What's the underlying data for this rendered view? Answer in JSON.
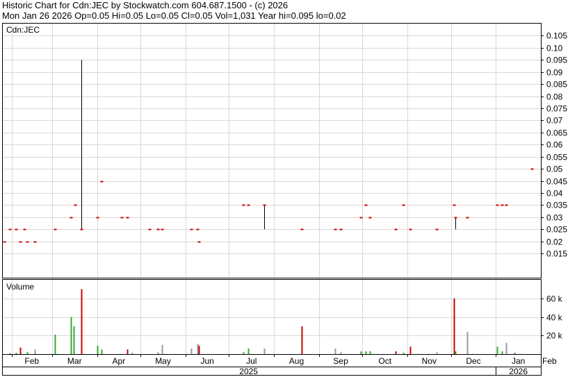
{
  "header": {
    "line1": "Historic Chart for Cdn:JEC by Stockwatch.com 604.687.1500 - (c) 2026",
    "line2": "Mon Jan 26 2026  Op=0.05  Hi=0.05  Lo=0.05  Cl=0.05  Vol=1,031  Year hi=0.095  lo=0.02"
  },
  "chart_data": {
    "type": "line",
    "title": "Historic Chart for Cdn:JEC",
    "price_panel": {
      "label": "Cdn:JEC",
      "ylim": [
        0.005,
        0.11
      ],
      "yticks": [
        0.015,
        0.02,
        0.025,
        0.03,
        0.035,
        0.04,
        0.045,
        0.05,
        0.055,
        0.06,
        0.065,
        0.07,
        0.075,
        0.08,
        0.085,
        0.09,
        0.095,
        0.1,
        0.105
      ],
      "ytick_labels": [
        "0.015",
        "0.02",
        "0.025",
        "0.03",
        "0.035",
        "0.04",
        "0.045",
        "0.05",
        "0.055",
        "0.06",
        "0.065",
        "0.07",
        "0.075",
        "0.08",
        "0.085",
        "0.09",
        "0.095",
        "0.10",
        "0.105"
      ],
      "bars": [
        {
          "date": "2025-01-27",
          "open": 0.02,
          "high": 0.02,
          "low": 0.02,
          "close": 0.02
        },
        {
          "date": "2025-01-31",
          "open": 0.025,
          "high": 0.025,
          "low": 0.025,
          "close": 0.025
        },
        {
          "date": "2025-02-04",
          "open": 0.025,
          "high": 0.025,
          "low": 0.025,
          "close": 0.025
        },
        {
          "date": "2025-02-07",
          "open": 0.02,
          "high": 0.02,
          "low": 0.02,
          "close": 0.02
        },
        {
          "date": "2025-02-10",
          "open": 0.025,
          "high": 0.025,
          "low": 0.025,
          "close": 0.025
        },
        {
          "date": "2025-02-12",
          "open": 0.02,
          "high": 0.02,
          "low": 0.02,
          "close": 0.02
        },
        {
          "date": "2025-02-17",
          "open": 0.02,
          "high": 0.02,
          "low": 0.02,
          "close": 0.02
        },
        {
          "date": "2025-03-03",
          "open": 0.025,
          "high": 0.025,
          "low": 0.025,
          "close": 0.025
        },
        {
          "date": "2025-03-14",
          "open": 0.03,
          "high": 0.03,
          "low": 0.03,
          "close": 0.03
        },
        {
          "date": "2025-03-17",
          "open": 0.035,
          "high": 0.035,
          "low": 0.035,
          "close": 0.035
        },
        {
          "date": "2025-03-21",
          "open": 0.025,
          "high": 0.095,
          "low": 0.025,
          "close": 0.025
        },
        {
          "date": "2025-04-01",
          "open": 0.03,
          "high": 0.03,
          "low": 0.03,
          "close": 0.03
        },
        {
          "date": "2025-04-04",
          "open": 0.045,
          "high": 0.045,
          "low": 0.045,
          "close": 0.045
        },
        {
          "date": "2025-04-18",
          "open": 0.03,
          "high": 0.03,
          "low": 0.03,
          "close": 0.03
        },
        {
          "date": "2025-04-22",
          "open": 0.03,
          "high": 0.03,
          "low": 0.03,
          "close": 0.03
        },
        {
          "date": "2025-05-07",
          "open": 0.025,
          "high": 0.025,
          "low": 0.025,
          "close": 0.025
        },
        {
          "date": "2025-05-13",
          "open": 0.025,
          "high": 0.025,
          "low": 0.025,
          "close": 0.025
        },
        {
          "date": "2025-05-16",
          "open": 0.025,
          "high": 0.025,
          "low": 0.025,
          "close": 0.025
        },
        {
          "date": "2025-06-05",
          "open": 0.025,
          "high": 0.025,
          "low": 0.025,
          "close": 0.025
        },
        {
          "date": "2025-06-09",
          "open": 0.025,
          "high": 0.025,
          "low": 0.025,
          "close": 0.025
        },
        {
          "date": "2025-06-10",
          "open": 0.02,
          "high": 0.02,
          "low": 0.02,
          "close": 0.02
        },
        {
          "date": "2025-07-11",
          "open": 0.035,
          "high": 0.035,
          "low": 0.035,
          "close": 0.035
        },
        {
          "date": "2025-07-14",
          "open": 0.035,
          "high": 0.035,
          "low": 0.035,
          "close": 0.035
        },
        {
          "date": "2025-07-25",
          "open": 0.035,
          "high": 0.035,
          "low": 0.025,
          "close": 0.035
        },
        {
          "date": "2025-08-20",
          "open": 0.025,
          "high": 0.025,
          "low": 0.025,
          "close": 0.025
        },
        {
          "date": "2025-09-12",
          "open": 0.025,
          "high": 0.025,
          "low": 0.025,
          "close": 0.025
        },
        {
          "date": "2025-09-16",
          "open": 0.025,
          "high": 0.025,
          "low": 0.025,
          "close": 0.025
        },
        {
          "date": "2025-09-30",
          "open": 0.03,
          "high": 0.03,
          "low": 0.03,
          "close": 0.03
        },
        {
          "date": "2025-10-03",
          "open": 0.035,
          "high": 0.035,
          "low": 0.035,
          "close": 0.035
        },
        {
          "date": "2025-10-06",
          "open": 0.03,
          "high": 0.03,
          "low": 0.03,
          "close": 0.03
        },
        {
          "date": "2025-10-24",
          "open": 0.025,
          "high": 0.025,
          "low": 0.025,
          "close": 0.025
        },
        {
          "date": "2025-10-29",
          "open": 0.035,
          "high": 0.035,
          "low": 0.035,
          "close": 0.035
        },
        {
          "date": "2025-11-03",
          "open": 0.025,
          "high": 0.025,
          "low": 0.025,
          "close": 0.025
        },
        {
          "date": "2025-11-21",
          "open": 0.025,
          "high": 0.025,
          "low": 0.025,
          "close": 0.025
        },
        {
          "date": "2025-12-03",
          "open": 0.035,
          "high": 0.035,
          "low": 0.035,
          "close": 0.035
        },
        {
          "date": "2025-12-04",
          "open": 0.025,
          "high": 0.03,
          "low": 0.025,
          "close": 0.03
        },
        {
          "date": "2025-12-12",
          "open": 0.03,
          "high": 0.03,
          "low": 0.03,
          "close": 0.03
        },
        {
          "date": "2026-01-02",
          "open": 0.035,
          "high": 0.035,
          "low": 0.035,
          "close": 0.035
        },
        {
          "date": "2026-01-05",
          "open": 0.035,
          "high": 0.035,
          "low": 0.035,
          "close": 0.035
        },
        {
          "date": "2026-01-08",
          "open": 0.035,
          "high": 0.035,
          "low": 0.035,
          "close": 0.035
        },
        {
          "date": "2026-01-26",
          "open": 0.05,
          "high": 0.05,
          "low": 0.05,
          "close": 0.05
        }
      ]
    },
    "volume_panel": {
      "label": "Volume",
      "ylim": [
        0,
        80000
      ],
      "yticks": [
        20000,
        40000,
        60000
      ],
      "ytick_labels": [
        "20 k",
        "40 k",
        "60 k"
      ],
      "bars": [
        {
          "date": "2025-01-31",
          "volume": 1000,
          "color": "#33aa33"
        },
        {
          "date": "2025-02-04",
          "volume": 1500,
          "color": "#33aa33"
        },
        {
          "date": "2025-02-07",
          "volume": 7000,
          "color": "#cc0000"
        },
        {
          "date": "2025-02-12",
          "volume": 2000,
          "color": "#33aa33"
        },
        {
          "date": "2025-02-17",
          "volume": 5000,
          "color": "#999999"
        },
        {
          "date": "2025-03-03",
          "volume": 21000,
          "color": "#33aa33"
        },
        {
          "date": "2025-03-14",
          "volume": 40000,
          "color": "#33aa33"
        },
        {
          "date": "2025-03-16",
          "volume": 30000,
          "color": "#33aa33"
        },
        {
          "date": "2025-03-21",
          "volume": 70000,
          "color": "#cc0000"
        },
        {
          "date": "2025-04-01",
          "volume": 9000,
          "color": "#33aa33"
        },
        {
          "date": "2025-04-04",
          "volume": 5000,
          "color": "#33aa33"
        },
        {
          "date": "2025-04-22",
          "volume": 5000,
          "color": "#cc0000"
        },
        {
          "date": "2025-04-25",
          "volume": 1500,
          "color": "#999999"
        },
        {
          "date": "2025-05-13",
          "volume": 2000,
          "color": "#999999"
        },
        {
          "date": "2025-05-16",
          "volume": 10000,
          "color": "#999999"
        },
        {
          "date": "2025-06-05",
          "volume": 6000,
          "color": "#999999"
        },
        {
          "date": "2025-06-09",
          "volume": 11000,
          "color": "#999999"
        },
        {
          "date": "2025-06-10",
          "volume": 9000,
          "color": "#cc0000"
        },
        {
          "date": "2025-07-11",
          "volume": 2000,
          "color": "#33aa33"
        },
        {
          "date": "2025-07-14",
          "volume": 6000,
          "color": "#33aa33"
        },
        {
          "date": "2025-07-25",
          "volume": 6000,
          "color": "#999999"
        },
        {
          "date": "2025-08-20",
          "volume": 30000,
          "color": "#cc0000"
        },
        {
          "date": "2025-09-12",
          "volume": 6000,
          "color": "#999999"
        },
        {
          "date": "2025-09-16",
          "volume": 2000,
          "color": "#999999"
        },
        {
          "date": "2025-09-30",
          "volume": 3000,
          "color": "#33aa33"
        },
        {
          "date": "2025-10-03",
          "volume": 3000,
          "color": "#33aa33"
        },
        {
          "date": "2025-10-06",
          "volume": 3000,
          "color": "#33aa33"
        },
        {
          "date": "2025-10-24",
          "volume": 3000,
          "color": "#cc0000"
        },
        {
          "date": "2025-10-29",
          "volume": 1500,
          "color": "#33aa33"
        },
        {
          "date": "2025-11-03",
          "volume": 8000,
          "color": "#cc0000"
        },
        {
          "date": "2025-11-21",
          "volume": 2000,
          "color": "#999999"
        },
        {
          "date": "2025-12-03",
          "volume": 60000,
          "color": "#cc0000"
        },
        {
          "date": "2025-12-04",
          "volume": 3000,
          "color": "#33aa33"
        },
        {
          "date": "2025-12-12",
          "volume": 24000,
          "color": "#999999"
        },
        {
          "date": "2026-01-02",
          "volume": 8000,
          "color": "#33aa33"
        },
        {
          "date": "2026-01-05",
          "volume": 3000,
          "color": "#33aa33"
        },
        {
          "date": "2026-01-08",
          "volume": 12000,
          "color": "#999999"
        },
        {
          "date": "2026-01-14",
          "volume": 1500,
          "color": "#33aa33"
        }
      ]
    },
    "x_axis": {
      "months": [
        {
          "label": "Feb",
          "date": "2025-02-01"
        },
        {
          "label": "Mar",
          "date": "2025-03-01"
        },
        {
          "label": "Apr",
          "date": "2025-04-01"
        },
        {
          "label": "May",
          "date": "2025-05-01"
        },
        {
          "label": "Jun",
          "date": "2025-06-01"
        },
        {
          "label": "Jul",
          "date": "2025-07-01"
        },
        {
          "label": "Aug",
          "date": "2025-08-01"
        },
        {
          "label": "Sep",
          "date": "2025-09-01"
        },
        {
          "label": "Oct",
          "date": "2025-10-01"
        },
        {
          "label": "Nov",
          "date": "2025-11-01"
        },
        {
          "label": "Dec",
          "date": "2025-12-01"
        },
        {
          "label": "Jan",
          "date": "2026-01-01"
        },
        {
          "label": "Feb",
          "date": "2026-02-01"
        }
      ],
      "years": [
        {
          "label": "2025",
          "start": "2025-01-01",
          "end": "2025-12-31"
        },
        {
          "label": "2026",
          "start": "2026-01-01",
          "end": "2026-02-01"
        }
      ],
      "range": [
        "2025-01-26",
        "2026-02-01"
      ]
    },
    "colors": {
      "price_tick": "#cc0000",
      "price_range": "#000000",
      "grid": "#d8d8d8",
      "frame": "#000000"
    },
    "grid": true
  }
}
